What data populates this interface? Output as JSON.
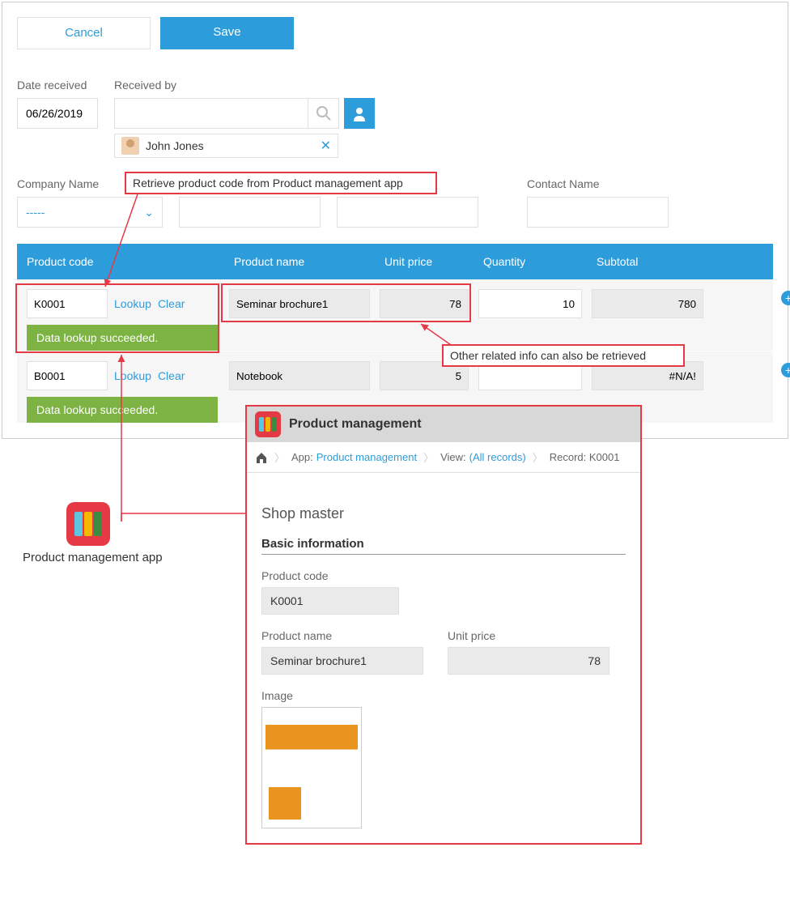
{
  "buttons": {
    "cancel": "Cancel",
    "save": "Save"
  },
  "labels": {
    "date_received": "Date received",
    "received_by": "Received by",
    "company_name": "Company Name",
    "contact_name": "Contact Name"
  },
  "date_received": "06/26/2019",
  "received_by": {
    "value": "",
    "user_name": "John Jones"
  },
  "company_select": "-----",
  "table": {
    "headers": {
      "code": "Product code",
      "name": "Product name",
      "price": "Unit price",
      "qty": "Quantity",
      "subtotal": "Subtotal"
    },
    "rows": [
      {
        "code": "K0001",
        "lookup": "Lookup",
        "clear": "Clear",
        "success": "Data lookup succeeded.",
        "name": "Seminar brochure1",
        "price": "78",
        "qty": "10",
        "subtotal": "780"
      },
      {
        "code": "B0001",
        "lookup": "Lookup",
        "clear": "Clear",
        "success": "Data lookup succeeded.",
        "name": "Notebook",
        "price": "5",
        "qty": "",
        "subtotal": "#N/A!"
      }
    ]
  },
  "annotations": {
    "a1": "Retrieve product code from Product management app",
    "a2": "Other related info can also be retrieved"
  },
  "app_label": "Product management app",
  "detail": {
    "title": "Product management",
    "breadcrumb": {
      "app_label": "App:",
      "app_link": "Product management",
      "view_label": "View:",
      "view_link": "(All records)",
      "record_label": "Record: K0001"
    },
    "section": "Shop master",
    "sub": "Basic information",
    "fields": {
      "code_label": "Product code",
      "code_value": "K0001",
      "name_label": "Product name",
      "name_value": "Seminar brochure1",
      "price_label": "Unit price",
      "price_value": "78",
      "image_label": "Image"
    }
  }
}
